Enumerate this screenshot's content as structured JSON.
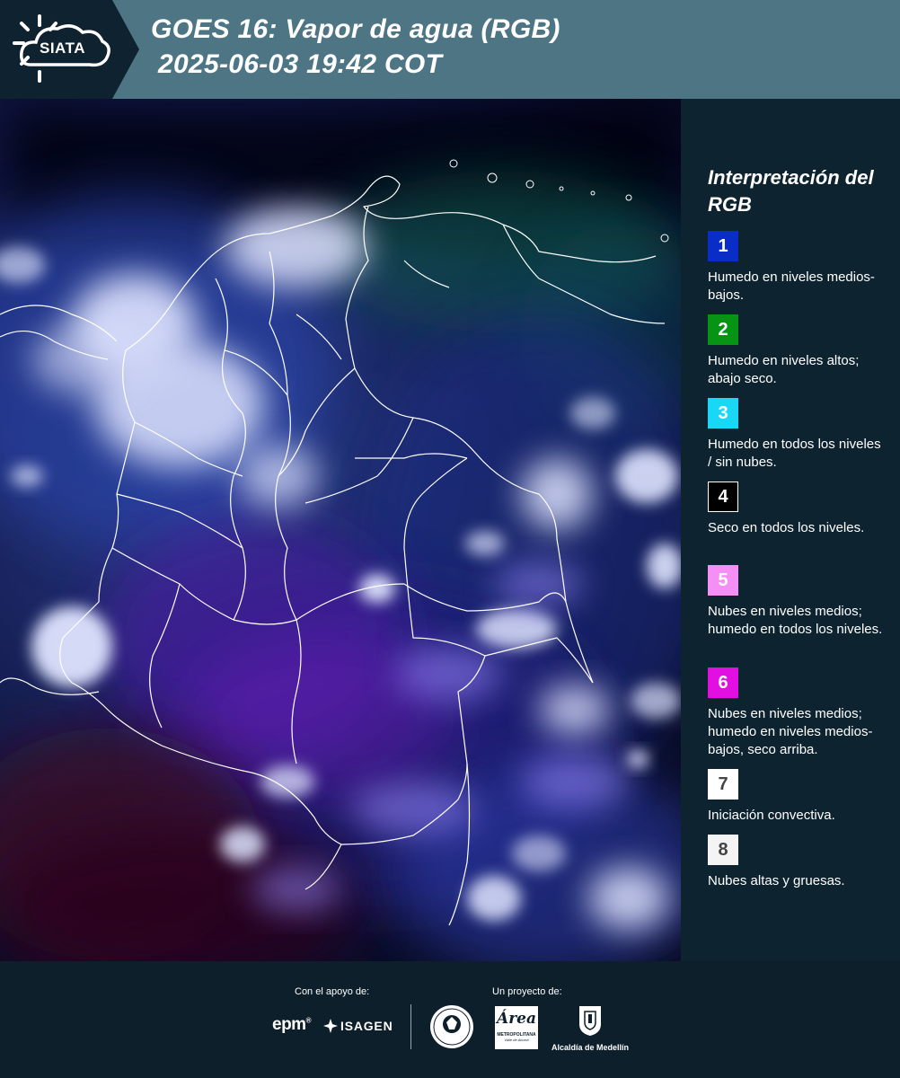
{
  "header": {
    "logo_text": "SIATA",
    "title_line1": "GOES 16: Vapor de agua (RGB)",
    "title_line2": "2025-06-03 19:42 COT"
  },
  "legend": {
    "title": "Interpretación del RGB",
    "items": [
      {
        "number": "1",
        "color": "#0a2dc8",
        "text_color": "#ffffff",
        "description": "Humedo en niveles medios-bajos."
      },
      {
        "number": "2",
        "color": "#079414",
        "text_color": "#ffffff",
        "description": "Humedo en niveles altos; abajo seco."
      },
      {
        "number": "3",
        "color": "#18d8f5",
        "text_color": "#ffffff",
        "description": "Humedo en todos los niveles / sin nubes."
      },
      {
        "number": "4",
        "color": "#000000",
        "text_color": "#ffffff",
        "description": "Seco en todos los niveles."
      },
      {
        "number": "5",
        "color": "#f58ef5",
        "text_color": "#ffffff",
        "description": "Nubes en niveles medios; humedo en todos los niveles."
      },
      {
        "number": "6",
        "color": "#e20fe2",
        "text_color": "#ffffff",
        "description": "Nubes en niveles medios; humedo en niveles medios-bajos, seco arriba."
      },
      {
        "number": "7",
        "color": "#ffffff",
        "text_color": "#444444",
        "description": "Iniciación convectiva."
      },
      {
        "number": "8",
        "color": "#f4f4f4",
        "text_color": "#444444",
        "description": "Nubes altas y gruesas."
      }
    ]
  },
  "footer": {
    "support_caption": "Con el apoyo de:",
    "project_caption": "Un proyecto de:",
    "epm": "epm",
    "epm_mark": "®",
    "isagen": "ISAGEN",
    "area_script": "Área",
    "area_sub": "METROPOLITANA",
    "area_sub2": "Valle de Aburrá",
    "medellin": "Alcaldía de Medellín"
  }
}
